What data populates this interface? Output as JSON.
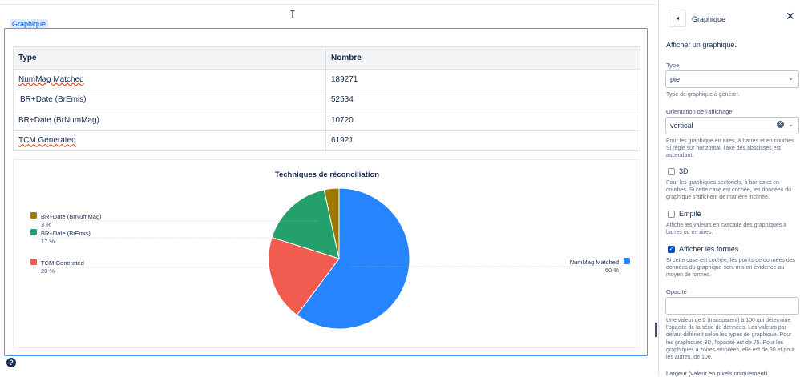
{
  "macro_label": "Graphique",
  "table": {
    "headers": [
      "Type",
      "Nombre"
    ],
    "rows": [
      {
        "type": "NumMag Matched",
        "count": "189271"
      },
      {
        "type": "BR+Date (BrEmis)",
        "count": "52534"
      },
      {
        "type": "BR+Date (BrNumMag)",
        "count": "10720"
      },
      {
        "type": "TCM Generated",
        "count": "61921"
      }
    ]
  },
  "chart_data": {
    "type": "pie",
    "title": "Techniques de réconciliation",
    "slices": [
      {
        "name": "NumMag Matched",
        "value": 189271,
        "percent_label": "60 %",
        "color": "#2684ff"
      },
      {
        "name": "TCM Generated",
        "value": 61921,
        "percent_label": "20 %",
        "color": "#f15b50"
      },
      {
        "name": "BR+Date (BrEmis)",
        "value": 52534,
        "percent_label": "17 %",
        "color": "#23a06b"
      },
      {
        "name": "BR+Date (BrNumMag)",
        "value": 10720,
        "percent_label": "3 %",
        "color": "#9e7900"
      }
    ]
  },
  "side": {
    "title": "Graphique",
    "description": "Afficher un graphique.",
    "type_label": "Type",
    "type_value": "pie",
    "type_help": "Type de graphique à générer.",
    "orient_label": "Orientation de l'affichage",
    "orient_value": "vertical",
    "orient_help": "Pour les graphique en aires, à barres et en courbes. Si réglé sur horizontal, l'axe des abscisses est ascendant.",
    "chk3d_label": "3D",
    "chk3d_help": "Pour les graphiques sectoriels, à barres et en courbes. Si cette case est cochée, les données du graphique s'affichent de manière inclinée.",
    "stacked_label": "Empilé",
    "stacked_help": "Affiche les valeurs en cascade des graphiques à barres ou en aires.",
    "shapes_label": "Afficher les formes",
    "shapes_help": "Si cette case est cochée, les points de données des données du graphique sont mis en évidence au moyen de formes.",
    "opacity_label": "Opacité",
    "opacity_value": "",
    "opacity_help": "Une valeur de 0 (transparent) à 100 qui détermine l'opacité de la série de données. Les valeurs par défaut diffèrent selon les types de graphique. Pour les graphiques 3D, l'opacité est de 75. Pour les graphiques à zones empilées, elle est de 50 et pour les autres, de 100.",
    "width_label": "Largeur (valeur en pixels uniquement)"
  },
  "icons": {
    "close": "close-icon",
    "chevron": "chevron-down-icon",
    "clear": "clear-icon",
    "help": "help-icon",
    "check": "check-icon"
  }
}
